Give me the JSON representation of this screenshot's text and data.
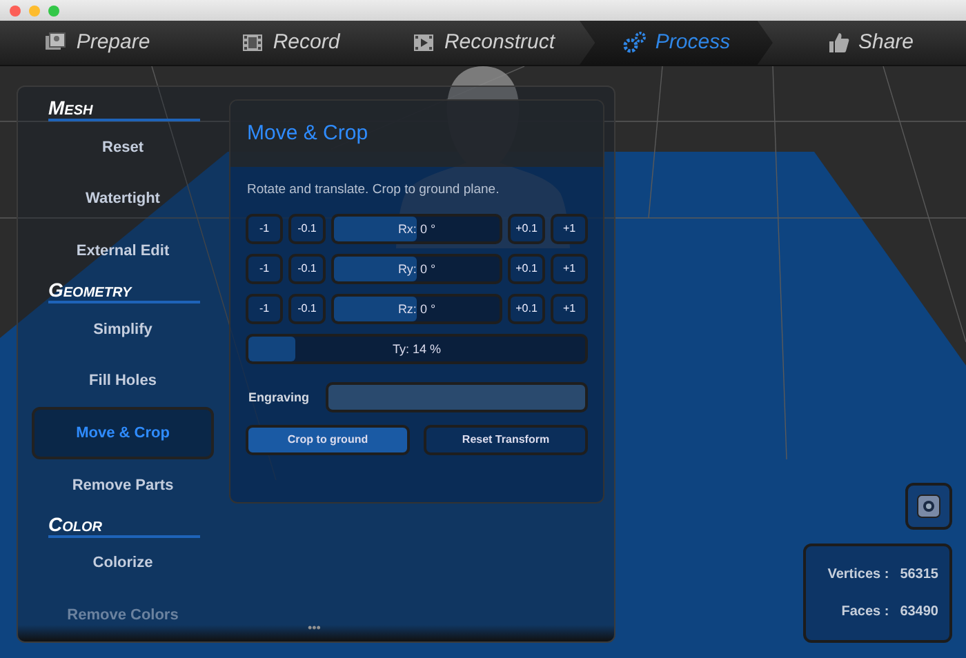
{
  "tabs": [
    {
      "label": "Prepare",
      "selected": false
    },
    {
      "label": "Record",
      "selected": false
    },
    {
      "label": "Reconstruct",
      "selected": false
    },
    {
      "label": "Process",
      "selected": true
    },
    {
      "label": "Share",
      "selected": false
    }
  ],
  "sidebar": {
    "sections": [
      {
        "title": "Mesh",
        "items": [
          {
            "label": "Reset",
            "selected": false
          },
          {
            "label": "Watertight",
            "selected": false
          },
          {
            "label": "External Edit",
            "selected": false
          }
        ]
      },
      {
        "title": "Geometry",
        "items": [
          {
            "label": "Simplify",
            "selected": false
          },
          {
            "label": "Fill Holes",
            "selected": false
          },
          {
            "label": "Move & Crop",
            "selected": true
          },
          {
            "label": "Remove Parts",
            "selected": false
          }
        ]
      },
      {
        "title": "Color",
        "items": [
          {
            "label": "Colorize",
            "selected": false
          },
          {
            "label": "Remove Colors",
            "selected": false
          }
        ]
      }
    ],
    "more_indicator": "•••"
  },
  "dialog": {
    "title": "Move & Crop",
    "description": "Rotate and translate. Crop to ground plane.",
    "rotation_rows": [
      {
        "minus": [
          "-1",
          "-0.1"
        ],
        "slider": {
          "label": "Rx: 0 °",
          "level": 0.5
        },
        "plus": [
          "+0.1",
          "+1"
        ]
      },
      {
        "minus": [
          "-1",
          "-0.1"
        ],
        "slider": {
          "label": "Ry: 0 °",
          "level": 0.5
        },
        "plus": [
          "+0.1",
          "+1"
        ]
      },
      {
        "minus": [
          "-1",
          "-0.1"
        ],
        "slider": {
          "label": "Rz: 0 °",
          "level": 0.5
        },
        "plus": [
          "+0.1",
          "+1"
        ]
      }
    ],
    "translation": {
      "label": "Ty: 14 %",
      "level": 0.14
    },
    "engraving": {
      "label": "Engraving"
    },
    "buttons": [
      {
        "label": "Crop to ground",
        "primary": true
      },
      {
        "label": "Reset Transform",
        "primary": false
      }
    ]
  },
  "stats": [
    {
      "label": "Vertices :",
      "value": "56315"
    },
    {
      "label": "Faces :",
      "value": "63490"
    }
  ]
}
